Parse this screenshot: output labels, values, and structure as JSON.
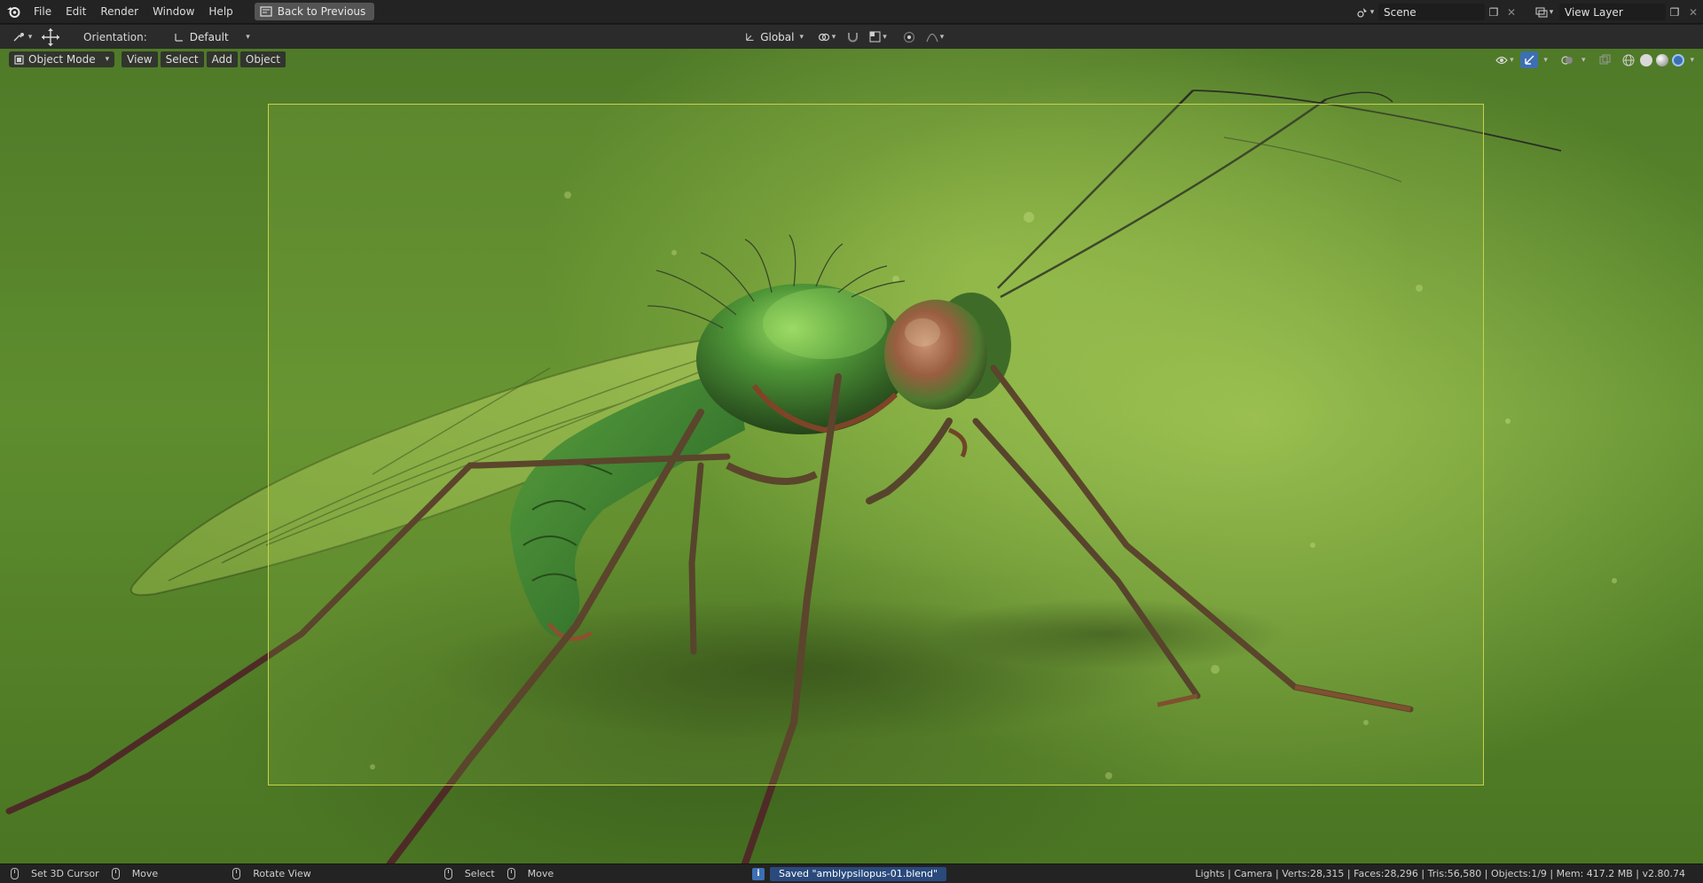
{
  "topbar": {
    "menus": [
      "File",
      "Edit",
      "Render",
      "Window",
      "Help"
    ],
    "back_button": "Back to Previous",
    "scene_value": "Scene",
    "view_layer_value": "View Layer"
  },
  "toolheader": {
    "orientation_label": "Orientation:",
    "orientation_value": "Default",
    "transform_orientation": "Global"
  },
  "viewport_header": {
    "mode": "Object Mode",
    "menus": [
      "View",
      "Select",
      "Add",
      "Object"
    ]
  },
  "statusbar": {
    "set_cursor": "Set 3D Cursor",
    "move1": "Move",
    "rotate": "Rotate View",
    "select": "Select",
    "move2": "Move",
    "saved_message": "Saved \"amblypsilopus-01.blend\"",
    "stats": "Lights | Camera | Verts:28,315 | Faces:28,296 | Tris:56,580 | Objects:1/9 | Mem: 417.2 MB | v2.80.74"
  },
  "colors": {
    "accent_blue": "#3d6fb3",
    "camera_frame": "#c9d14a",
    "background_green": "#5e8d2e"
  }
}
